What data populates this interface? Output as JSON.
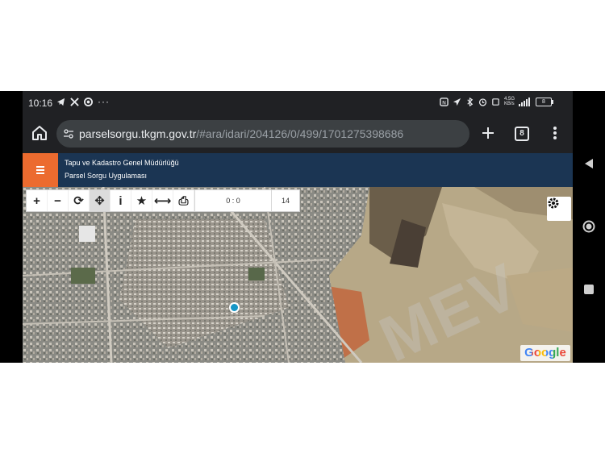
{
  "status_bar": {
    "time": "10:16",
    "overflow": "···",
    "battery": "8",
    "network_top": "4.5G",
    "network_bottom": "KB/s"
  },
  "browser": {
    "url_host": "parselsorgu.tkgm.gov.tr",
    "url_path": "/#ara/idari/204126/0/499/1701275398686",
    "tab_count": "8"
  },
  "app": {
    "title_line1": "Tapu ve Kadastro Genel Müdürlüğü",
    "title_line2": "Parsel Sorgu Uygulaması"
  },
  "map_toolbar": {
    "tools": [
      {
        "name": "zoom-in",
        "glyph": "+"
      },
      {
        "name": "zoom-out",
        "glyph": "−"
      },
      {
        "name": "refresh",
        "glyph": "⟳"
      },
      {
        "name": "locate",
        "glyph": "✥"
      },
      {
        "name": "info",
        "glyph": "i"
      },
      {
        "name": "favorite",
        "glyph": "★"
      },
      {
        "name": "measure",
        "glyph": "⟷"
      },
      {
        "name": "print",
        "glyph": "⎙"
      }
    ],
    "coordinates": "0 : 0",
    "zoom_level": "14"
  },
  "map": {
    "attribution": "Google",
    "watermark": "MEV"
  },
  "colors": {
    "header_bg": "#1b3553",
    "accent_orange": "#ec6b2f",
    "marker": "#1596c6"
  }
}
